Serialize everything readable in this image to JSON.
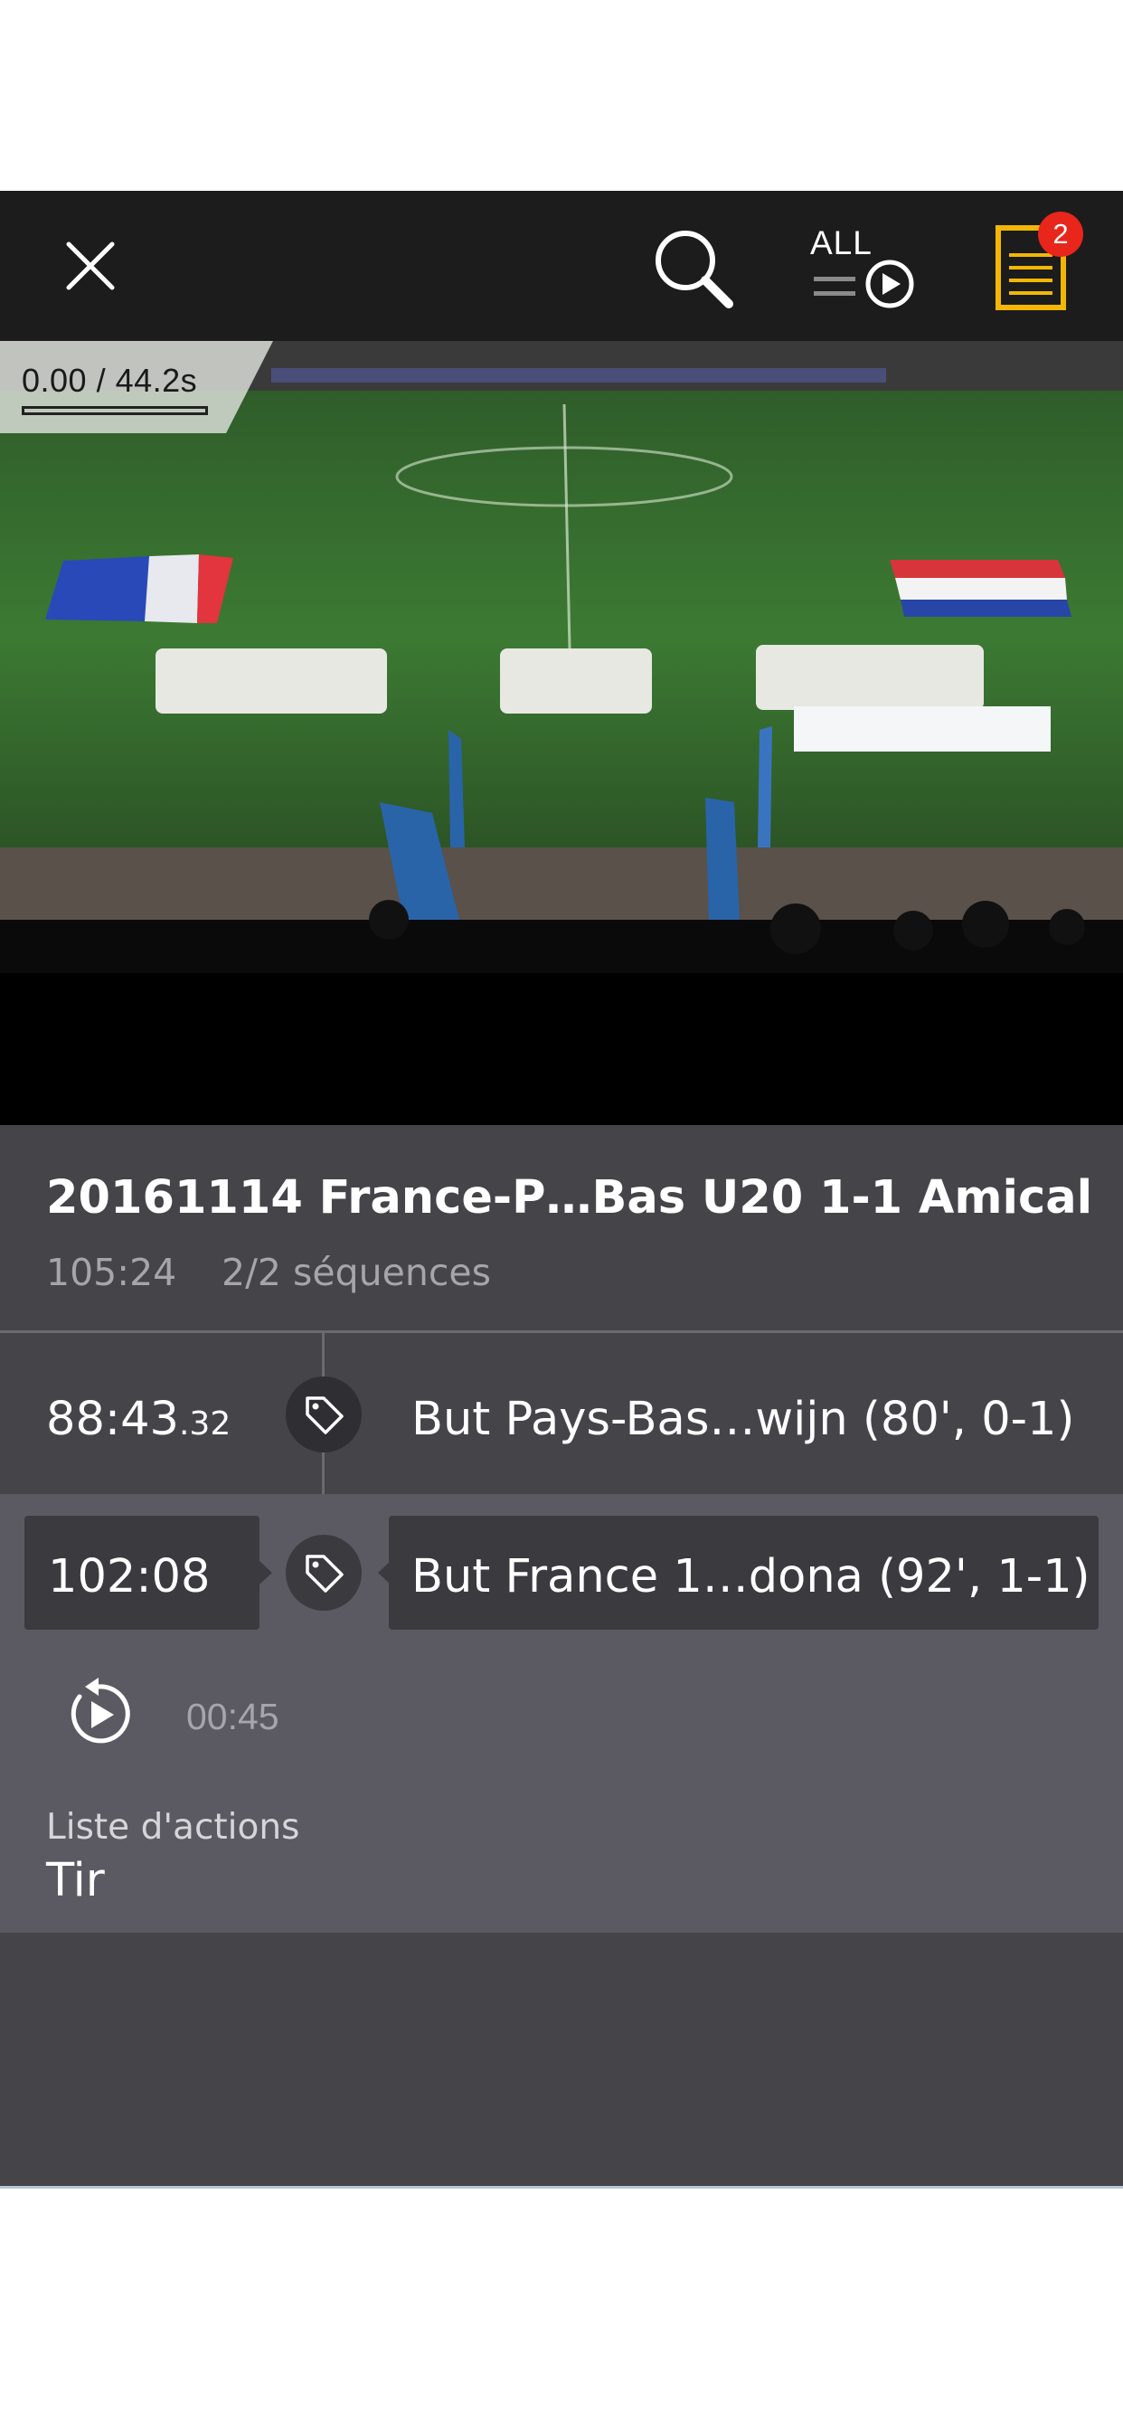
{
  "header": {
    "all_label": "ALL",
    "notes_badge": "2",
    "accent_color": "#f2b705",
    "badge_color": "#e8261b"
  },
  "player": {
    "time_readout": "0.00 / 44.2s",
    "progress": 0.0
  },
  "match": {
    "title": "20161114 France-P…Bas U20 1-1 Amical",
    "duration": "105:24",
    "sequences": "2/2 séquences"
  },
  "sequences": [
    {
      "time_main": "88:43",
      "time_fraction": ".32",
      "label": "But Pays-Bas…wijn (80', 0-1)"
    },
    {
      "time": "102:08",
      "label": "But France 1…dona (92', 1-1)",
      "replay_duration": "00:45",
      "actions_label": "Liste d'actions",
      "actions_value": "Tir"
    }
  ]
}
